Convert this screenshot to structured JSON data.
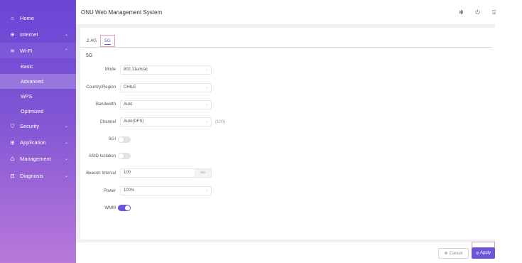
{
  "app": {
    "title": "ONU Web Management System"
  },
  "sidebar": {
    "items": [
      {
        "label": "Home",
        "icon": "home-icon"
      },
      {
        "label": "Internet",
        "icon": "globe-icon"
      },
      {
        "label": "Wi-Fi",
        "icon": "wifi-icon"
      },
      {
        "label": "Security",
        "icon": "shield-icon"
      },
      {
        "label": "Application",
        "icon": "grid-icon"
      },
      {
        "label": "Management",
        "icon": "users-icon"
      },
      {
        "label": "Diagnosis",
        "icon": "toolbox-icon"
      }
    ],
    "wifi_sub": [
      "Basic",
      "Advanced",
      "WPS",
      "Optimized"
    ],
    "active_sub": "Advanced"
  },
  "header_icons": [
    "settings-icon",
    "power-icon",
    "logout-icon"
  ],
  "tabs": [
    "2.4G",
    "5G"
  ],
  "active_tab": "5G",
  "section": {
    "title": "5G"
  },
  "form": {
    "mode": {
      "label": "Mode",
      "value": "802.11a/n/ac"
    },
    "country": {
      "label": "Country/Region",
      "value": "CHILE"
    },
    "bandwidth": {
      "label": "Bandwidth",
      "value": "Auto"
    },
    "channel": {
      "label": "Channel",
      "value": "Auto(DFS)",
      "hint": "(100)"
    },
    "sgi": {
      "label": "SGI",
      "on": false
    },
    "ssid_isolation": {
      "label": "SSID Isolation",
      "on": false
    },
    "beacon": {
      "label": "Beacon Interval",
      "value": "100",
      "unit": "ms"
    },
    "power": {
      "label": "Power",
      "value": "100%"
    },
    "wmm": {
      "label": "WMM",
      "on": true
    }
  },
  "footer": {
    "cancel_label": "Cancel",
    "apply_label": "Apply"
  },
  "colors": {
    "accent": "#6b57d6",
    "sidebar_top": "#6a45d6",
    "sidebar_bottom": "#b979da"
  }
}
